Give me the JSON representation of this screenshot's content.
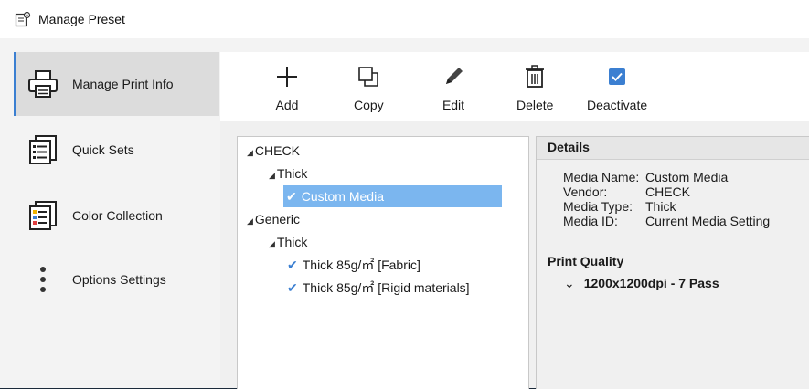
{
  "window": {
    "title": "Manage Preset"
  },
  "sidebar": {
    "items": [
      {
        "label": "Manage Print Info",
        "icon": "printer-icon",
        "active": true
      },
      {
        "label": "Quick Sets",
        "icon": "document-list-icon",
        "active": false
      },
      {
        "label": "Color Collection",
        "icon": "color-document-icon",
        "active": false
      },
      {
        "label": "Options Settings",
        "icon": "more-vertical-icon",
        "active": false
      }
    ]
  },
  "toolbar": {
    "add_label": "Add",
    "copy_label": "Copy",
    "edit_label": "Edit",
    "delete_label": "Delete",
    "deactivate_label": "Deactivate"
  },
  "tree": {
    "root1": "CHECK",
    "root1_child": "Thick",
    "root1_item": "Custom Media",
    "root2": "Generic",
    "root2_child": "Thick",
    "root2_item1": "Thick 85g/㎡ [Fabric]",
    "root2_item2": "Thick 85g/㎡ [Rigid materials]"
  },
  "details": {
    "header": "Details",
    "media_name_label": "Media Name:",
    "media_name_value": "Custom Media",
    "vendor_label": "Vendor:",
    "vendor_value": "CHECK",
    "media_type_label": "Media Type:",
    "media_type_value": "Thick",
    "media_id_label": "Media ID:",
    "media_id_value": "Current Media Setting",
    "print_quality_title": "Print Quality",
    "print_quality_item": "1200x1200dpi - 7 Pass"
  },
  "colors": {
    "accent": "#3b7fd1",
    "selection": "#7bb6ef"
  }
}
